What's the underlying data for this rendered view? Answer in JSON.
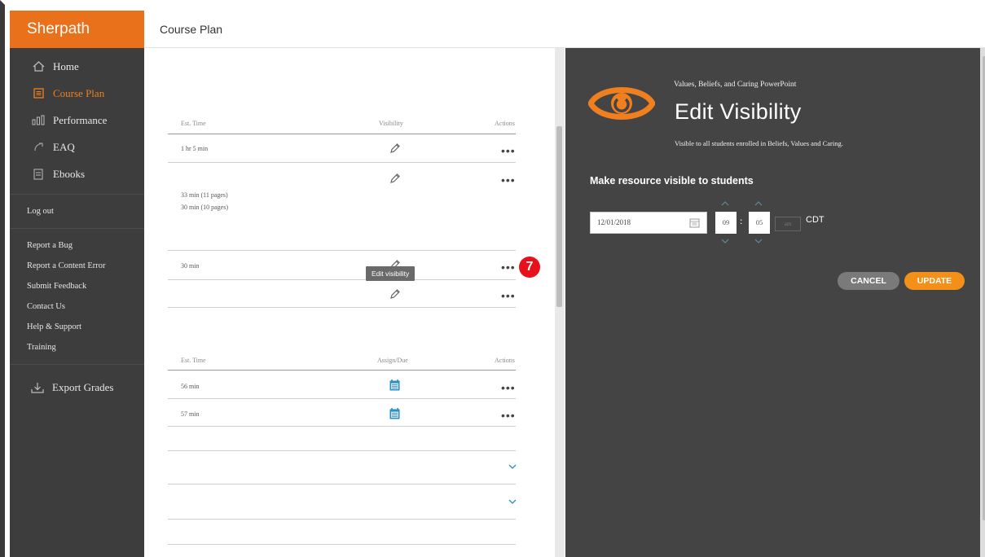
{
  "brand": "Sherpath",
  "nav": {
    "items": [
      {
        "label": "Home",
        "icon": "home-icon"
      },
      {
        "label": "Course Plan",
        "icon": "course-plan-icon",
        "active": true
      },
      {
        "label": "Performance",
        "icon": "performance-icon"
      },
      {
        "label": "EAQ",
        "icon": "eaq-icon"
      },
      {
        "label": "Ebooks",
        "icon": "ebooks-icon"
      }
    ],
    "logout": "Log out",
    "links": [
      "Report a Bug",
      "Report a Content Error",
      "Submit Feedback",
      "Contact Us",
      "Help & Support",
      "Training"
    ],
    "export": "Export Grades"
  },
  "header": {
    "title": "Course Plan"
  },
  "content": {
    "section1": {
      "col_time": "Est. Time",
      "col_visibility": "Visibility",
      "col_actions": "Actions",
      "rows": [
        {
          "time": "1 hr 5 min"
        },
        {
          "time": "33 min (11 pages)",
          "time2": "30 min (10 pages)"
        },
        {
          "time": "30 min"
        },
        {
          "time": ""
        }
      ]
    },
    "section2": {
      "col_time": "Est. Time",
      "col_assign": "Assign/Due",
      "col_actions": "Actions",
      "rows": [
        {
          "time": "56 min"
        },
        {
          "time": "57 min"
        }
      ]
    },
    "dots": "•••",
    "tooltip": "Edit visibility",
    "badge": "7"
  },
  "panel": {
    "subtitle": "Values, Beliefs, and Caring PowerPoint",
    "title": "Edit Visibility",
    "description": "Visible to all students enrolled in Beliefs, Values and Caring.",
    "section_title": "Make resource visible to students",
    "date": "12/01/2018",
    "hour": "09",
    "minute": "05",
    "ampm": "am",
    "timezone": "CDT",
    "cancel": "CANCEL",
    "update": "UPDATE",
    "accent": "#f39019"
  }
}
